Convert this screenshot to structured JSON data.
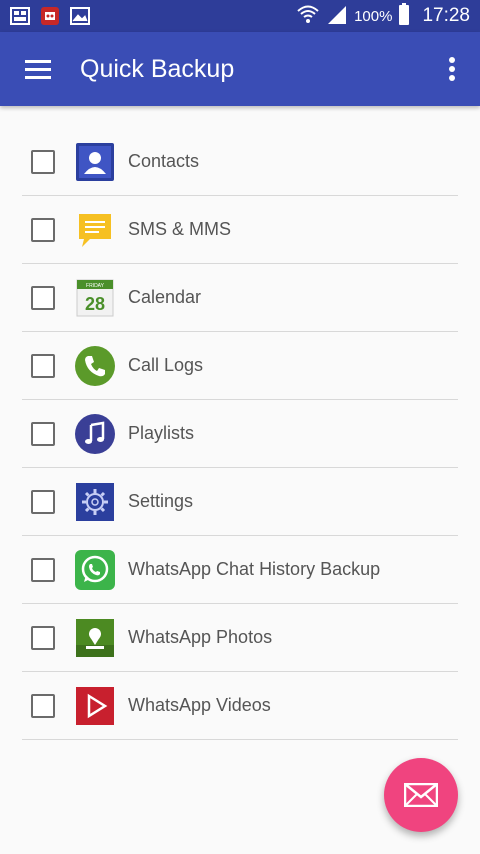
{
  "status_bar": {
    "notification_icons": [
      "gallery-icon",
      "app-notification-icon",
      "image-icon"
    ],
    "wifi_icon": "wifi-icon",
    "signal_icon": "signal-icon",
    "battery_percent": "100%",
    "battery_icon": "battery-icon",
    "time": "17:28"
  },
  "app_bar": {
    "menu_icon": "hamburger-menu-icon",
    "title": "Quick Backup",
    "more_icon": "more-vert-icon",
    "color": "#3a4db5"
  },
  "items": [
    {
      "label": "Contacts",
      "icon": "contacts-icon",
      "checked": false
    },
    {
      "label": "SMS & MMS",
      "icon": "sms-icon",
      "checked": false
    },
    {
      "label": "Calendar",
      "icon": "calendar-icon",
      "checked": false,
      "icon_text": {
        "day": "FRIDAY",
        "date": "28"
      }
    },
    {
      "label": "Call Logs",
      "icon": "phone-icon",
      "checked": false
    },
    {
      "label": "Playlists",
      "icon": "music-note-icon",
      "checked": false
    },
    {
      "label": "Settings",
      "icon": "gear-icon",
      "checked": false
    },
    {
      "label": "WhatsApp Chat History Backup",
      "icon": "whatsapp-icon",
      "checked": false
    },
    {
      "label": "WhatsApp Photos",
      "icon": "photo-download-icon",
      "checked": false
    },
    {
      "label": "WhatsApp Videos",
      "icon": "video-play-icon",
      "checked": false
    }
  ],
  "fab": {
    "icon": "envelope-icon",
    "color": "#f0447f"
  }
}
